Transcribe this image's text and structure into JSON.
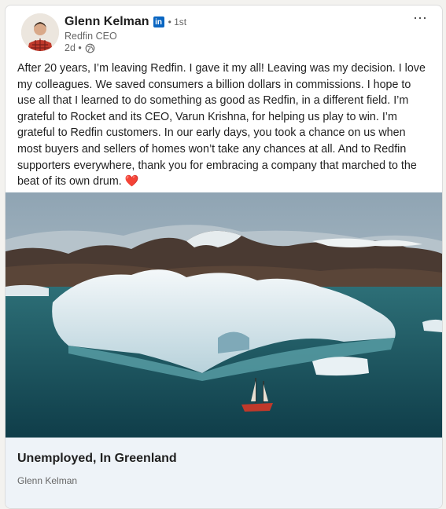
{
  "post": {
    "author_name": "Glenn Kelman",
    "linkedin_badge": "in",
    "connection_degree": "• 1st",
    "author_headline": "Redfin CEO",
    "timestamp": "2d •",
    "visibility_icon": "globe-icon",
    "more_menu": "⋯",
    "text": "After 20 years, I’m leaving Redfin. I gave it my all! Leaving was my decision. I love my colleagues. We saved consumers a billion dollars in commissions. I hope to use all that I learned to do something as good as Redfin, in a different field. I’m grateful to Rocket and its CEO, Varun Krishna, for helping us play to win. I’m grateful to Redfin customers. In our early days, you took a chance on us when most buyers and sellers of homes won’t take any chances at all. And to Redfin supporters everywhere, thank you for embracing a company that marched to the beat of its own drum.",
    "emoji": "❤️"
  },
  "article": {
    "title": "Unemployed, In Greenland",
    "source": "Glenn Kelman"
  },
  "colors": {
    "linkedin_blue": "#0a66c2",
    "heart_red": "#e03131",
    "footer_bg": "#eef3f8"
  }
}
